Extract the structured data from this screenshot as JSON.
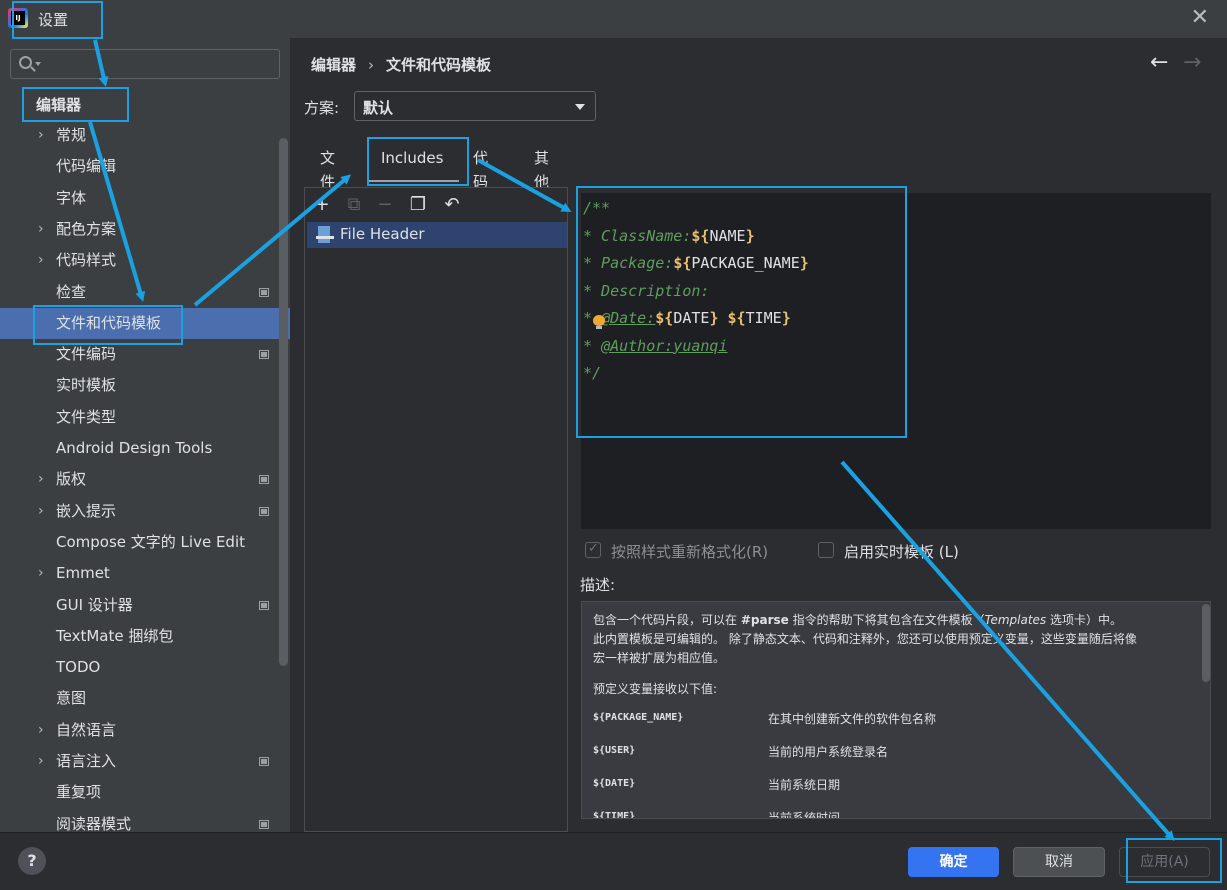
{
  "window": {
    "title": "设置"
  },
  "search": {
    "value": "",
    "placeholder": ""
  },
  "sidebar": {
    "root_label": "编辑器",
    "items": [
      {
        "label": "常规",
        "expandable": true,
        "badge": false
      },
      {
        "label": "代码编辑",
        "expandable": false,
        "badge": false
      },
      {
        "label": "字体",
        "expandable": false,
        "badge": false
      },
      {
        "label": "配色方案",
        "expandable": true,
        "badge": false
      },
      {
        "label": "代码样式",
        "expandable": true,
        "badge": false
      },
      {
        "label": "检查",
        "expandable": false,
        "badge": true
      },
      {
        "label": "文件和代码模板",
        "expandable": false,
        "badge": false,
        "selected": true
      },
      {
        "label": "文件编码",
        "expandable": false,
        "badge": true
      },
      {
        "label": "实时模板",
        "expandable": false,
        "badge": false
      },
      {
        "label": "文件类型",
        "expandable": false,
        "badge": false
      },
      {
        "label": "Android Design Tools",
        "expandable": false,
        "badge": false
      },
      {
        "label": "版权",
        "expandable": true,
        "badge": true
      },
      {
        "label": "嵌入提示",
        "expandable": true,
        "badge": true
      },
      {
        "label": "Compose 文字的 Live Edit",
        "expandable": false,
        "badge": false
      },
      {
        "label": "Emmet",
        "expandable": true,
        "badge": false
      },
      {
        "label": "GUI 设计器",
        "expandable": false,
        "badge": true
      },
      {
        "label": "TextMate 捆绑包",
        "expandable": false,
        "badge": false
      },
      {
        "label": "TODO",
        "expandable": false,
        "badge": false
      },
      {
        "label": "意图",
        "expandable": false,
        "badge": false
      },
      {
        "label": "自然语言",
        "expandable": true,
        "badge": false
      },
      {
        "label": "语言注入",
        "expandable": true,
        "badge": true
      },
      {
        "label": "重复项",
        "expandable": false,
        "badge": false
      },
      {
        "label": "阅读器模式",
        "expandable": false,
        "badge": true
      }
    ]
  },
  "breadcrumb": {
    "parent": "编辑器",
    "sep": "›",
    "current": "文件和代码模板"
  },
  "nav": {
    "back": "←",
    "forward": "→"
  },
  "scheme": {
    "label": "方案:",
    "value": "默认"
  },
  "tabs": [
    {
      "label": "文件"
    },
    {
      "label": "Includes",
      "active": true
    },
    {
      "label": "代码"
    },
    {
      "label": "其他"
    }
  ],
  "toolbar": {
    "add": "+",
    "copy_add": "⧉",
    "remove": "−",
    "copy": "❐",
    "reset": "↶"
  },
  "template_list": [
    {
      "label": "File Header"
    }
  ],
  "editor": {
    "lines": [
      [
        {
          "t": "/**",
          "c": "c-com"
        }
      ],
      [
        {
          "t": "* ClassName:",
          "c": "c-com"
        },
        {
          "t": "${",
          "c": "c-dollar"
        },
        {
          "t": "NAME",
          "c": "c-var"
        },
        {
          "t": "}",
          "c": "c-dollar"
        }
      ],
      [
        {
          "t": "* Package:",
          "c": "c-com"
        },
        {
          "t": "${",
          "c": "c-dollar"
        },
        {
          "t": "PACKAGE_NAME",
          "c": "c-var"
        },
        {
          "t": "}",
          "c": "c-dollar"
        }
      ],
      [
        {
          "t": "* Description:",
          "c": "c-com"
        }
      ],
      [
        {
          "t": "* ",
          "c": "c-com"
        },
        {
          "t": "@Date:",
          "c": "c-tag"
        },
        {
          "t": "${",
          "c": "c-dollar"
        },
        {
          "t": "DATE",
          "c": "c-var"
        },
        {
          "t": "}",
          "c": "c-dollar"
        },
        {
          "t": " ",
          "c": "c-var"
        },
        {
          "t": "${",
          "c": "c-dollar"
        },
        {
          "t": "TIME",
          "c": "c-var"
        },
        {
          "t": "}",
          "c": "c-dollar"
        }
      ],
      [
        {
          "t": "* ",
          "c": "c-com"
        },
        {
          "t": "@Author:yuanqi",
          "c": "c-tag"
        }
      ],
      [
        {
          "t": "*/",
          "c": "c-com"
        }
      ]
    ]
  },
  "options": {
    "reformat": {
      "label": "按照样式重新格式化(R)",
      "checked": true,
      "disabled": true
    },
    "live_templates": {
      "label": "启用实时模板 (L)",
      "checked": false
    }
  },
  "description": {
    "label": "描述:",
    "line1_a": "包含一个代码片段，可以在 ",
    "line1_b": "#parse",
    "line1_c": " 指令的帮助下将其包含在文件模板（",
    "line1_d": "Templates",
    "line1_e": " 选项卡）中。",
    "line2": "此内置模板是可编辑的。 除了静态文本、代码和注释外，您还可以使用预定义变量，这些变量随后将像",
    "line3": "宏一样被扩展为相应值。",
    "vars_intro": "预定义变量接收以下值:",
    "vars": [
      {
        "name": "${PACKAGE_NAME}",
        "desc": "在其中创建新文件的软件包名称"
      },
      {
        "name": "${USER}",
        "desc": "当前的用户系统登录名"
      },
      {
        "name": "${DATE}",
        "desc": "当前系统日期"
      },
      {
        "name": "${TIME}",
        "desc": "当前系统时间"
      }
    ]
  },
  "footer": {
    "help": "?",
    "ok": "确定",
    "cancel": "取消",
    "apply": "应用(A)"
  },
  "colors": {
    "accent": "#3574f0",
    "selection": "#4b6eaf",
    "annotation": "#1ba1e2"
  }
}
